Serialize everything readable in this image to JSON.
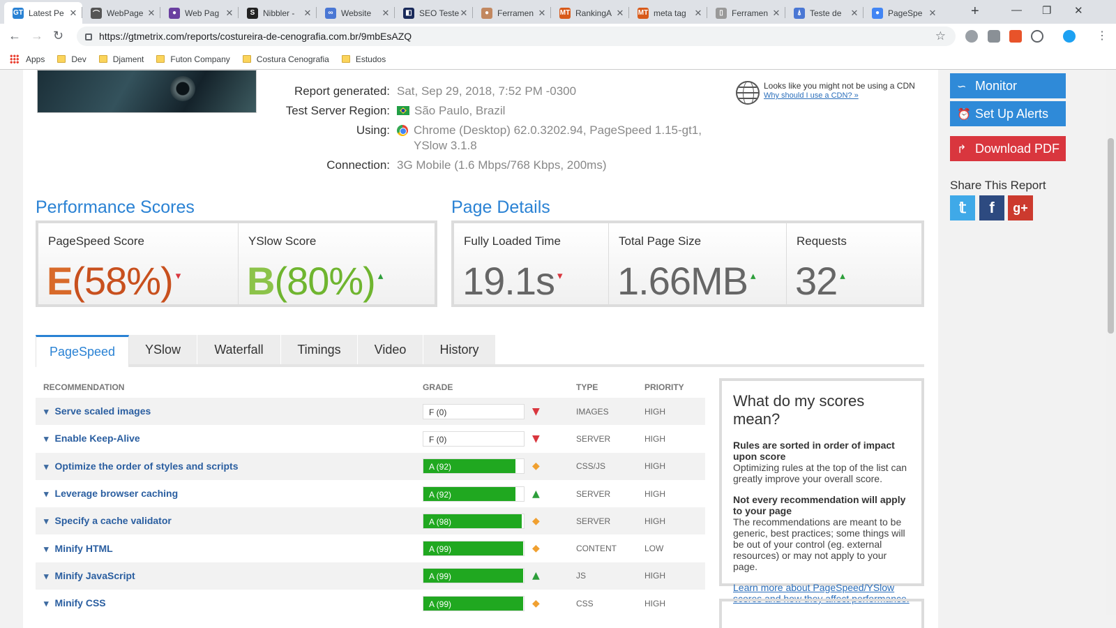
{
  "browser": {
    "tabs": [
      {
        "label": "Latest Pe",
        "fav_color": "#2a82d4",
        "fav_text": "GT"
      },
      {
        "label": "WebPage",
        "fav_color": "#555555",
        "fav_text": "⌒"
      },
      {
        "label": "Web Pag",
        "fav_color": "#6a3fa0",
        "fav_text": "●"
      },
      {
        "label": "Nibbler -",
        "fav_color": "#222222",
        "fav_text": "S"
      },
      {
        "label": "Website",
        "fav_color": "#4a77d4",
        "fav_text": "∞"
      },
      {
        "label": "SEO Teste",
        "fav_color": "#1a2a5a",
        "fav_text": "◧"
      },
      {
        "label": "Ferramen",
        "fav_color": "#c28860",
        "fav_text": "●"
      },
      {
        "label": "RankingA",
        "fav_color": "#d85a1a",
        "fav_text": "MT"
      },
      {
        "label": "meta tag",
        "fav_color": "#d85a1a",
        "fav_text": "MT"
      },
      {
        "label": "Ferramen",
        "fav_color": "#999999",
        "fav_text": "▯"
      },
      {
        "label": "Teste de",
        "fav_color": "#4a77d4",
        "fav_text": "⍋"
      },
      {
        "label": "PageSpe",
        "fav_color": "#4285f4",
        "fav_text": "●"
      }
    ],
    "new_tab": "+",
    "url": "https://gtmetrix.com/reports/costureira-de-cenografia.com.br/9mbEsAZQ",
    "bookmarks": [
      "Apps",
      "Dev",
      "Djament",
      "Futon Company",
      "Costura Cenografia",
      "Estudos"
    ]
  },
  "report": {
    "generated_label": "Report generated:",
    "generated_value": "Sat, Sep 29, 2018, 7:52 PM -0300",
    "region_label": "Test Server Region:",
    "region_value": "São Paulo, Brazil",
    "using_label": "Using:",
    "using_value": "Chrome (Desktop) 62.0.3202.94, PageSpeed 1.15-gt1, YSlow 3.1.8",
    "connection_label": "Connection:",
    "connection_value": "3G Mobile (1.6 Mbps/768 Kbps, 200ms)"
  },
  "cdn": {
    "text": "Looks like you might not be using a CDN",
    "link": "Why should I use a CDN? »"
  },
  "performance": {
    "title": "Performance Scores",
    "pagespeed_label": "PageSpeed Score",
    "pagespeed_grade": "E",
    "pagespeed_pct": "(58%)",
    "pagespeed_trend": "▾",
    "yslow_label": "YSlow Score",
    "yslow_grade": "B",
    "yslow_pct": "(80%)",
    "yslow_trend": "▴"
  },
  "details": {
    "title": "Page Details",
    "load_label": "Fully Loaded Time",
    "load_value": "19.1s",
    "load_trend": "▾",
    "size_label": "Total Page Size",
    "size_value": "1.66MB",
    "size_trend": "▴",
    "req_label": "Requests",
    "req_value": "32",
    "req_trend": "▴"
  },
  "colors": {
    "grade_e": "#d86a2a",
    "grade_b": "#8cc34a",
    "down": "#d9363e",
    "up": "#2d9e3a",
    "neutral": "#f0a030",
    "bar_green": "#20a820",
    "link_blue": "#2a82d4"
  },
  "report_tabs": [
    "PageSpeed",
    "YSlow",
    "Waterfall",
    "Timings",
    "Video",
    "History"
  ],
  "table": {
    "headers": {
      "recommendation": "RECOMMENDATION",
      "grade": "GRADE",
      "type": "TYPE",
      "priority": "PRIORITY"
    },
    "rows": [
      {
        "name": "Serve scaled images",
        "grade": "F (0)",
        "score": 0,
        "trend": "down",
        "type": "IMAGES",
        "priority": "HIGH"
      },
      {
        "name": "Enable Keep-Alive",
        "grade": "F (0)",
        "score": 0,
        "trend": "down",
        "type": "SERVER",
        "priority": "HIGH"
      },
      {
        "name": "Optimize the order of styles and scripts",
        "grade": "A (92)",
        "score": 92,
        "trend": "neutral",
        "type": "CSS/JS",
        "priority": "HIGH"
      },
      {
        "name": "Leverage browser caching",
        "grade": "A (92)",
        "score": 92,
        "trend": "up",
        "type": "SERVER",
        "priority": "HIGH"
      },
      {
        "name": "Specify a cache validator",
        "grade": "A (98)",
        "score": 98,
        "trend": "neutral",
        "type": "SERVER",
        "priority": "HIGH"
      },
      {
        "name": "Minify HTML",
        "grade": "A (99)",
        "score": 99,
        "trend": "neutral",
        "type": "CONTENT",
        "priority": "LOW"
      },
      {
        "name": "Minify JavaScript",
        "grade": "A (99)",
        "score": 99,
        "trend": "up",
        "type": "JS",
        "priority": "HIGH"
      },
      {
        "name": "Minify CSS",
        "grade": "A (99)",
        "score": 99,
        "trend": "neutral",
        "type": "CSS",
        "priority": "HIGH"
      }
    ]
  },
  "help": {
    "title": "What do my scores mean?",
    "p1_bold": "Rules are sorted in order of impact upon score",
    "p1": "Optimizing rules at the top of the list can greatly improve your overall score.",
    "p2_bold": "Not every recommendation will apply to your page",
    "p2": "The recommendations are meant to be generic, best practices; some things will be out of your control (eg. external resources) or may not apply to your page.",
    "link": "Learn more about PageSpeed/YSlow scores and how they affect performance."
  },
  "sidebar": {
    "monitor": "Monitor",
    "alerts": "Set Up Alerts",
    "pdf": "Download PDF",
    "share_title": "Share This Report"
  }
}
